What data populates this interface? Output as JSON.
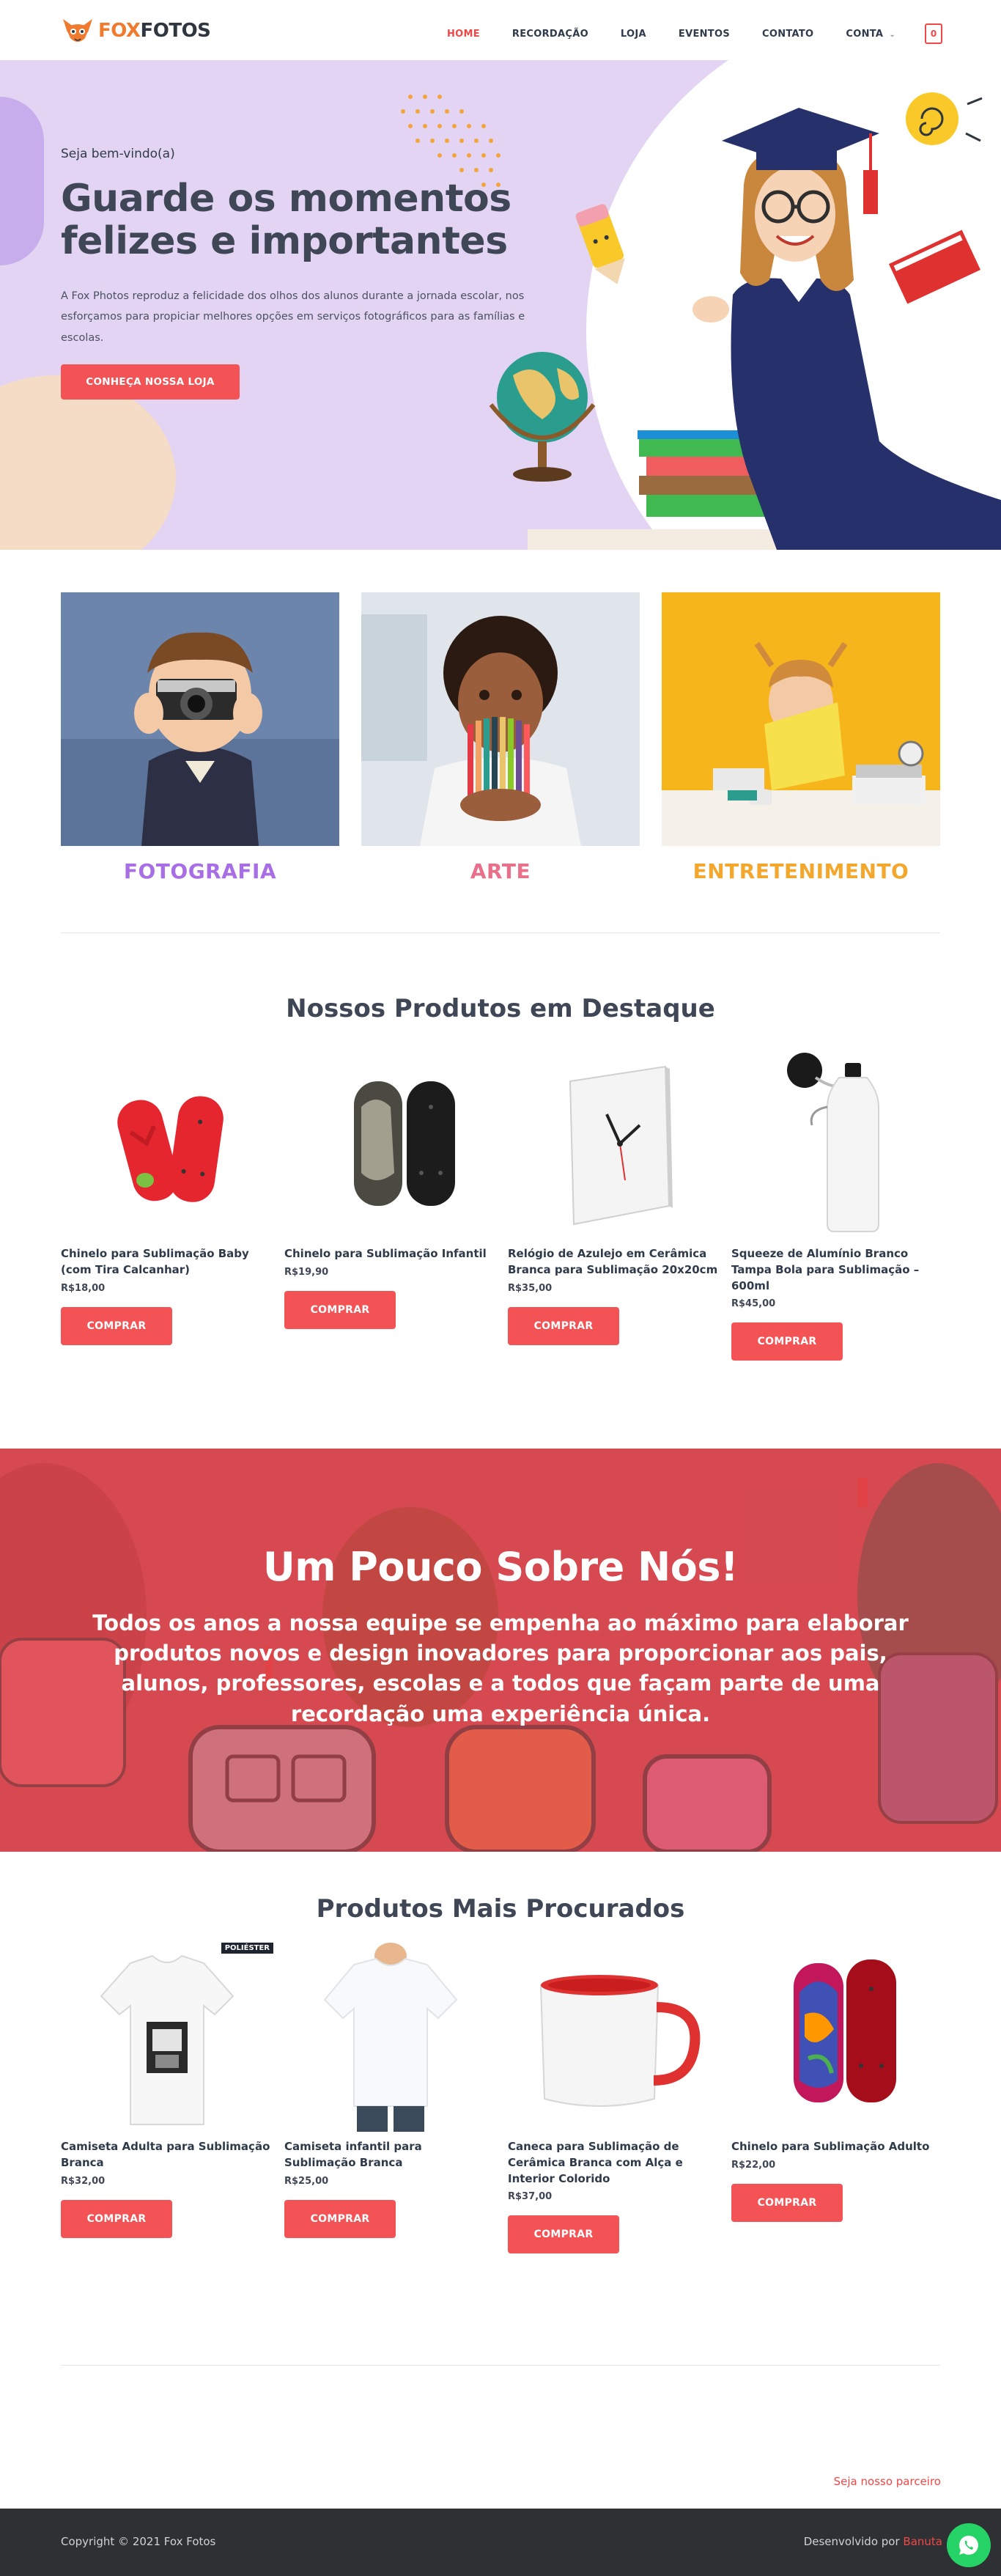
{
  "header": {
    "logo_fox": "FOX",
    "logo_fotos": "FOTOS",
    "nav": [
      "HOME",
      "RECORDAÇÃO",
      "LOJA",
      "EVENTOS",
      "CONTATO",
      "CONTA"
    ],
    "cart_count": "0"
  },
  "hero": {
    "greeting": "Seja bem-vindo(a)",
    "title": "Guarde os momentos felizes e importantes",
    "description": "A Fox Photos reproduz a felicidade dos olhos dos alunos durante a jornada escolar, nos esforçamos para propiciar melhores opções em serviços fotográficos para as famílias e escolas.",
    "button": "CONHEÇA NOSSA LOJA"
  },
  "categories": [
    {
      "label": "FOTOGRAFIA",
      "color": "#a86ee6"
    },
    {
      "label": "ARTE",
      "color": "#e9708a"
    },
    {
      "label": "ENTRETENIMENTO",
      "color": "#f3a72c"
    }
  ],
  "featured": {
    "title": "Nossos Produtos em Destaque",
    "products": [
      {
        "name": "Chinelo para Sublimação Baby (com Tira Calcanhar)",
        "price": "R$18,00",
        "button": "COMPRAR"
      },
      {
        "name": "Chinelo para Sublimação Infantil",
        "price": "R$19,90",
        "button": "COMPRAR"
      },
      {
        "name": "Relógio de Azulejo em Cerâmica Branca para Sublimação 20x20cm",
        "price": "R$35,00",
        "button": "COMPRAR"
      },
      {
        "name": "Squeeze de Alumínio Branco Tampa Bola para Sublimação – 600ml",
        "price": "R$45,00",
        "button": "COMPRAR"
      }
    ]
  },
  "about": {
    "title": "Um Pouco Sobre Nós!",
    "text": "Todos os anos a nossa equipe se empenha ao máximo para elaborar produtos novos e design inovadores para proporcionar aos pais, alunos, professores, escolas e a todos que façam parte de uma recordação uma experiência única."
  },
  "popular": {
    "title": "Produtos Mais Procurados",
    "badge": "POLIÉSTER",
    "products": [
      {
        "name": "Camiseta Adulta para Sublimação Branca",
        "price": "R$32,00",
        "button": "COMPRAR"
      },
      {
        "name": "Camiseta infantil para Sublimação Branca",
        "price": "R$25,00",
        "button": "COMPRAR"
      },
      {
        "name": "Caneca para Sublimação de Cerâmica Branca com Alça e Interior Colorido",
        "price": "R$37,00",
        "button": "COMPRAR"
      },
      {
        "name": "Chinelo para Sublimação Adulto",
        "price": "R$22,00",
        "button": "COMPRAR"
      }
    ]
  },
  "partner_link": "Seja nosso parceiro",
  "footer": {
    "copyright": "Copyright © 2021 Fox Fotos",
    "dev_prefix": "Desenvolvido por",
    "dev_brand": "Banuta"
  },
  "colors": {
    "accent": "#f45356",
    "hero_bg": "#e3d4f4",
    "about_bg": "#d85258",
    "footer_bg": "#2f3034"
  },
  "icons": [
    "fox-logo-icon",
    "chevron-down-icon",
    "cart-icon",
    "whatsapp-icon"
  ]
}
